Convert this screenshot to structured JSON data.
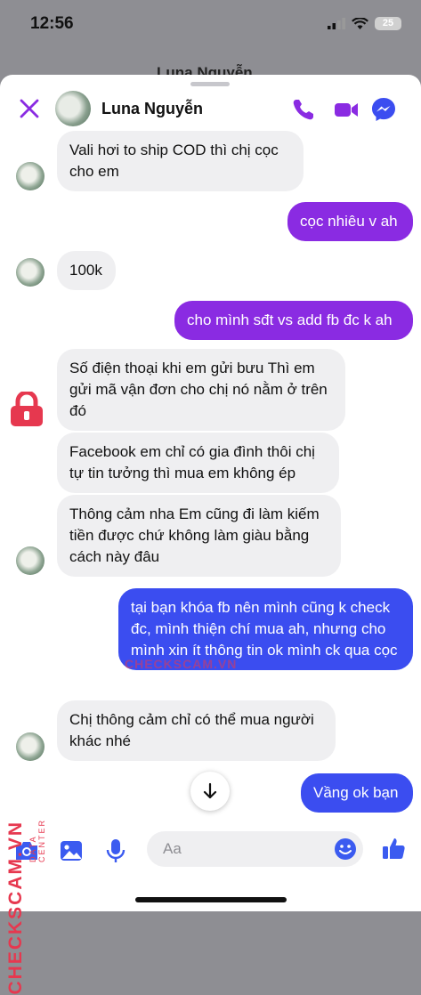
{
  "status_bar": {
    "time": "12:56",
    "battery": "25"
  },
  "background": {
    "title": "Luna Nguyễn"
  },
  "header": {
    "name": "Luna Nguyễn"
  },
  "messages": [
    {
      "side": "in",
      "text": "Vali hơi to ship COD thì chị cọc cho em"
    },
    {
      "side": "out",
      "text": "cọc nhiêu v ah"
    },
    {
      "side": "in",
      "text": "100k"
    },
    {
      "side": "out",
      "text": "cho mình sđt vs add fb đc k ah"
    },
    {
      "side": "in",
      "text": "Số điện thoại khi em gửi bưu Thì em gửi mã vận đơn cho chị nó nằm ở trên đó"
    },
    {
      "side": "in",
      "text": "Facebook em chỉ có gia đình thôi chị tự tin tưởng thì mua em không ép"
    },
    {
      "side": "in",
      "text": "Thông cảm nha Em cũng đi làm kiếm tiền được chứ không làm giàu bằng cách này đâu"
    },
    {
      "side": "out",
      "text": "tại bạn khóa fb nên mình cũng k check đc, mình thiện chí mua ah, nhưng cho mình xin ít thông tin ok mình ck qua cọc"
    },
    {
      "side": "in",
      "text": "Chị thông cảm chỉ có thể mua người khác nhé"
    },
    {
      "side": "out",
      "text": "Vầng ok bạn"
    }
  ],
  "composer": {
    "placeholder": "Aa"
  },
  "watermark": {
    "brand": "CHECKSCAM.VN",
    "sub": "DATA CENTER"
  },
  "colors": {
    "accent": "#8a2be2",
    "blue": "#3b4df0",
    "incoming": "#efeff1"
  },
  "icons": [
    "close-icon",
    "phone-icon",
    "video-icon",
    "messenger-icon",
    "camera-icon",
    "image-icon",
    "mic-icon",
    "emoji-icon",
    "like-icon",
    "arrow-down-icon"
  ]
}
